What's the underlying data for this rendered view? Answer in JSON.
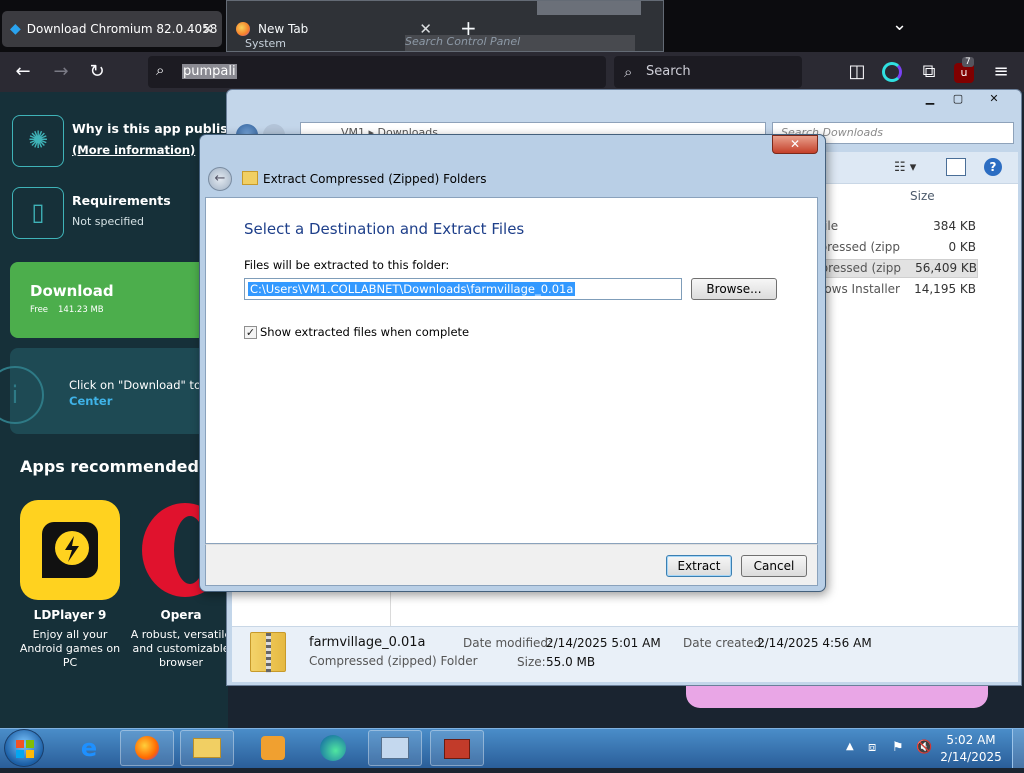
{
  "browser": {
    "tabs": [
      {
        "title": "Download Chromium 82.0.4058",
        "close": "✕"
      },
      {
        "title": "New Tab",
        "close": "✕"
      }
    ],
    "new_tab": "+",
    "tab_list": "⌄",
    "url_text": "pumpali",
    "search_placeholder": "Search",
    "notif_count": "7"
  },
  "behind_explorer_ghost": {
    "system": "System",
    "search": "Search Control Panel"
  },
  "page": {
    "why_title": "Why is this app published on Uptodown?",
    "more_info": "(More information)",
    "requirements_title": "Requirements",
    "requirements_value": "Not specified",
    "download_label": "Download",
    "download_free": "Free",
    "download_size": "141.23 MB",
    "click_text": "Click on \"Download\" to get the file. Center",
    "click_link": "Center",
    "recommended_title": "Apps recommended for you",
    "apps": [
      {
        "name": "LDPlayer 9",
        "desc": "Enjoy all your Android games on PC"
      },
      {
        "name": "Opera",
        "desc": "A robust, versatile and customizable browser"
      }
    ]
  },
  "explorer": {
    "breadcrumb": "VM1 ▸ Downloads",
    "search_placeholder": "Search Downloads",
    "column_size": "Size",
    "rows": [
      {
        "type": "File",
        "size": "384 KB"
      },
      {
        "type": "Compressed (zipp...",
        "size": "0 KB"
      },
      {
        "type": "Compressed (zipp...",
        "size": "56,409 KB"
      },
      {
        "type": "Windows Installer ...",
        "size": "14,195 KB"
      }
    ],
    "details": {
      "file_name": "farmvillage_0.01a",
      "file_type": "Compressed (zipped) Folder",
      "date_modified_label": "Date modified:",
      "date_modified": "2/14/2025 5:01 AM",
      "size_label": "Size:",
      "size": "55.0 MB",
      "date_created_label": "Date created:",
      "date_created": "2/14/2025 4:56 AM"
    }
  },
  "dialog": {
    "title": "Extract Compressed (Zipped) Folders",
    "heading": "Select a Destination and Extract Files",
    "path_label": "Files will be extracted to this folder:",
    "path_value": "C:\\Users\\VM1.COLLABNET\\Downloads\\farmvillage_0.01a",
    "browse": "Browse...",
    "checkbox_label": "Show extracted files when complete",
    "checkbox_checked": true,
    "extract": "Extract",
    "cancel": "Cancel",
    "close": "✕"
  },
  "taskbar": {
    "time": "5:02 AM",
    "date": "2/14/2025"
  },
  "colors": {
    "accent_green": "#4cae4c",
    "page_bg": "#163039",
    "dialog_heading": "#1e3f8a",
    "selection": "#3399ff"
  }
}
